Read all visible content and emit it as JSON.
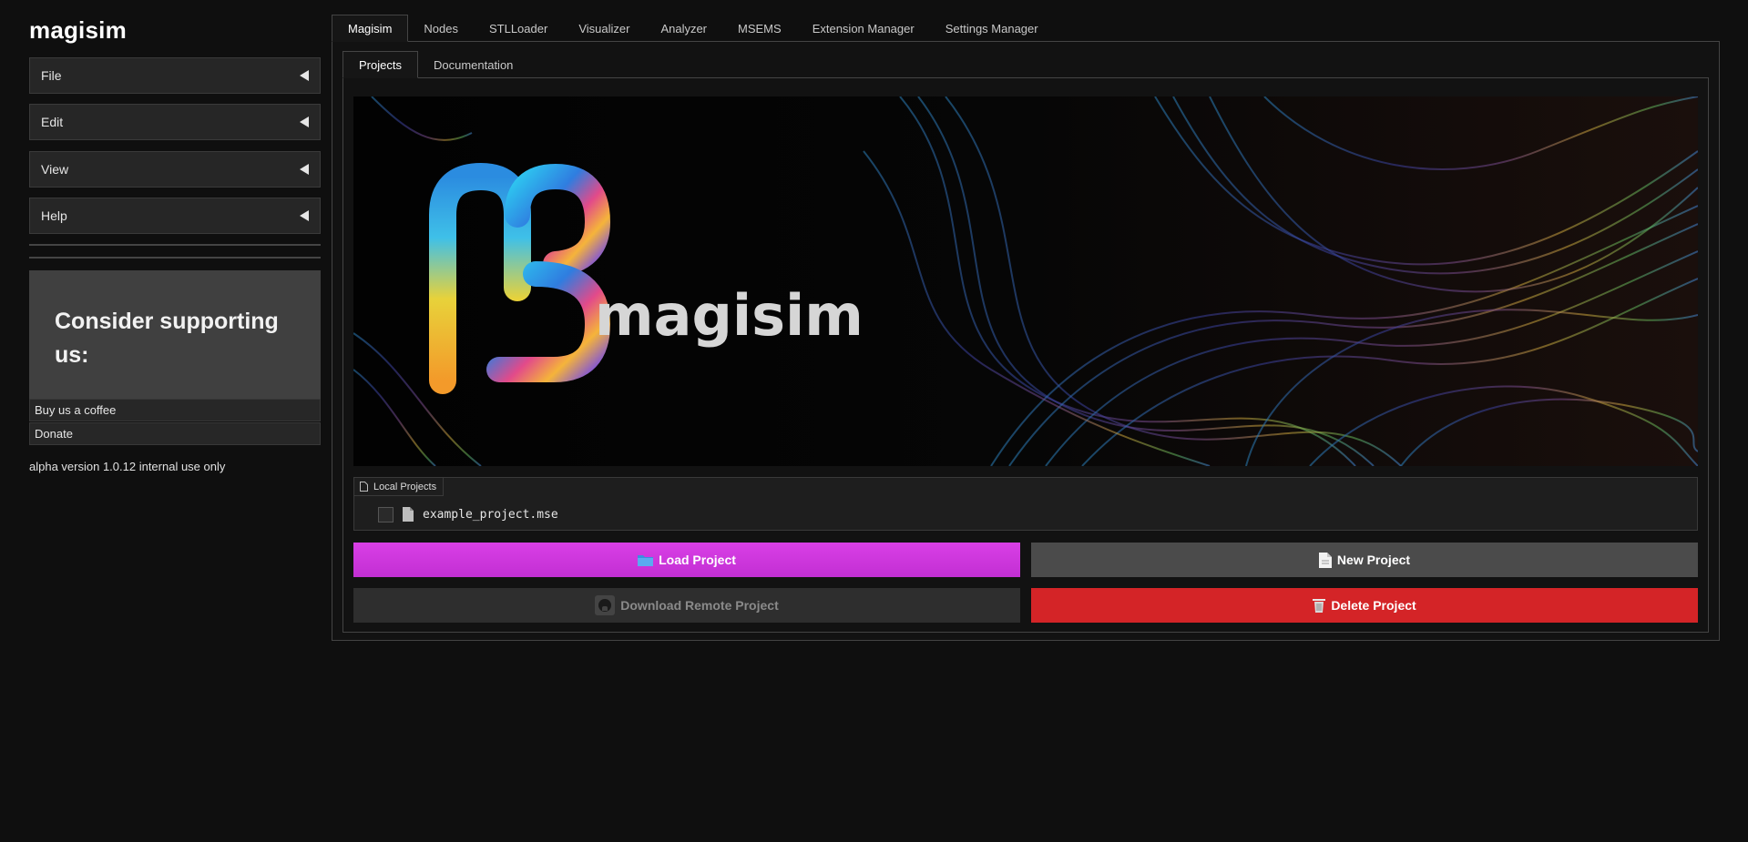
{
  "app": {
    "title": "magisim"
  },
  "sidebar": {
    "menus": [
      {
        "label": "File"
      },
      {
        "label": "Edit"
      },
      {
        "label": "View"
      },
      {
        "label": "Help"
      }
    ],
    "support": {
      "heading": "Consider supporting us:",
      "links": [
        {
          "label": "Buy us a coffee"
        },
        {
          "label": "Donate"
        }
      ]
    },
    "version": "alpha version 1.0.12 internal use only"
  },
  "tabs": [
    {
      "label": "Magisim",
      "active": true
    },
    {
      "label": "Nodes"
    },
    {
      "label": "STLLoader"
    },
    {
      "label": "Visualizer"
    },
    {
      "label": "Analyzer"
    },
    {
      "label": "MSEMS"
    },
    {
      "label": "Extension Manager"
    },
    {
      "label": "Settings Manager"
    }
  ],
  "subtabs": [
    {
      "label": "Projects",
      "active": true
    },
    {
      "label": "Documentation"
    }
  ],
  "banner": {
    "wordmark": "magisim"
  },
  "local_projects": {
    "label": "Local Projects",
    "files": [
      {
        "name": "example_project.mse",
        "checked": false
      }
    ]
  },
  "actions": {
    "load": {
      "icon": "folder-icon",
      "label": "Load Project"
    },
    "new": {
      "icon": "document-icon",
      "label": "New Project"
    },
    "download": {
      "icon": "github-icon",
      "label": "Download Remote Project"
    },
    "delete": {
      "icon": "trash-icon",
      "label": "Delete Project"
    }
  },
  "colors": {
    "load": "#c935dc",
    "new": "#4b4b4b",
    "download": "#2e2e2e",
    "delete": "#d42427"
  }
}
